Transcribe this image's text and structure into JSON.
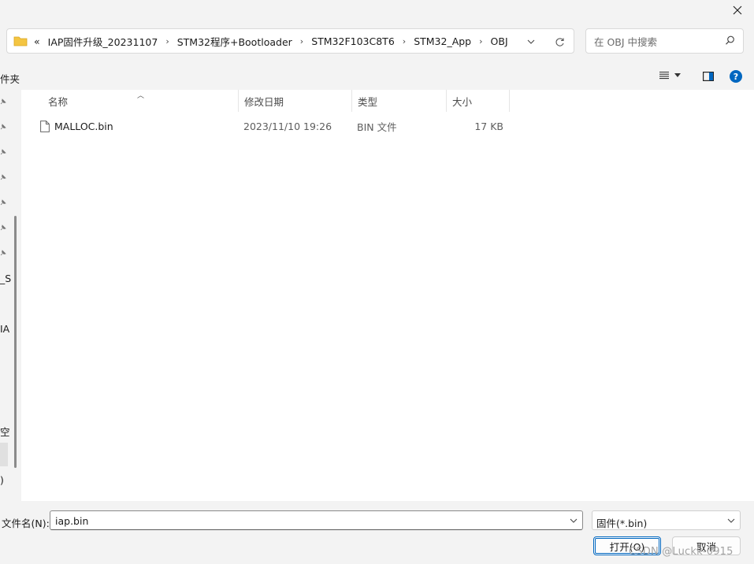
{
  "address": {
    "overflow": "«",
    "crumbs": [
      "IAP固件升级_20231107",
      "STM32程序+Bootloader",
      "STM32F103C8T6",
      "STM32_App",
      "OBJ"
    ]
  },
  "search": {
    "placeholder": "在 OBJ 中搜索"
  },
  "toolbar": {
    "new_folder_label": "件夹"
  },
  "nav": {
    "fragments": [
      "_S",
      "IA",
      "空",
      ")"
    ]
  },
  "columns": {
    "name": "名称",
    "date": "修改日期",
    "type": "类型",
    "size": "大小"
  },
  "files": [
    {
      "name": "MALLOC.bin",
      "date": "2023/11/10 19:26",
      "type": "BIN 文件",
      "size": "17 KB"
    }
  ],
  "footer": {
    "filename_label": "文件名(N):",
    "filename_value": "iap.bin",
    "filetype": "固件(*.bin)",
    "open_label": "打开(O)",
    "cancel_label": "取消"
  },
  "watermark": "CSDN @Luckk-0915",
  "colors": {
    "accent": "#0067c0",
    "folder": "#f4c542",
    "window_bg": "#f3f3f3"
  },
  "icons": [
    "close-icon",
    "folder-icon",
    "chevron-right-icon",
    "chevron-down-icon",
    "refresh-icon",
    "search-icon",
    "view-list-icon",
    "preview-pane-icon",
    "help-icon",
    "pin-icon",
    "file-icon"
  ]
}
